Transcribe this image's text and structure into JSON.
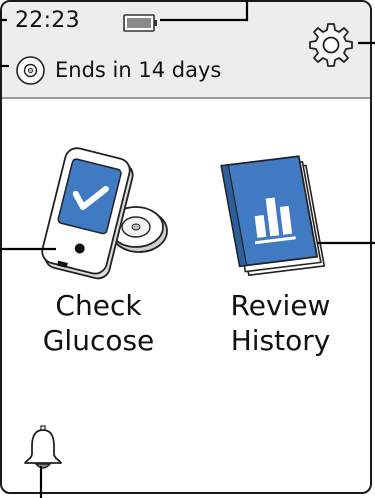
{
  "status_bar": {
    "time": "22:23",
    "battery_icon": "battery-icon",
    "sensor_icon": "sensor-icon",
    "sensor_status": "Ends in 14 days",
    "settings_icon": "gear-icon"
  },
  "main": {
    "check_glucose": {
      "icon": "glucose-reader-icon",
      "line1": "Check",
      "line2": "Glucose"
    },
    "review_history": {
      "icon": "history-logbook-icon",
      "line1": "Review",
      "line2": "History"
    }
  },
  "footer": {
    "alarm_icon": "bell-icon"
  },
  "colors": {
    "status_bar_bg": "#ededed",
    "accent_blue": "#3f7ac3",
    "outline": "#1a1a1a"
  }
}
